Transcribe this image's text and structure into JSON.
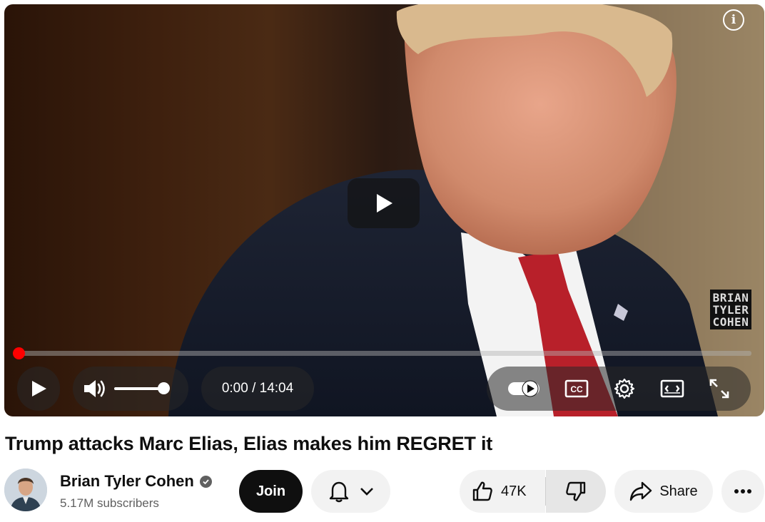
{
  "video": {
    "watermark": "BRIAN\nTYLER\nCOHEN",
    "progress_fraction": 0.0,
    "time": "0:00 / 14:04",
    "icons": [
      "info-icon",
      "play-icon",
      "volume-icon",
      "autoplay-toggle-icon",
      "cc-icon",
      "gear-icon",
      "miniplayer-icon",
      "fullscreen-icon"
    ]
  },
  "title": "Trump attacks Marc Elias, Elias makes him REGRET it",
  "channel": {
    "name": "Brian Tyler Cohen",
    "subscribers": "5.17M subscribers",
    "verified": true
  },
  "actions": {
    "join": "Join",
    "likes": "47K",
    "share": "Share"
  },
  "colors": {
    "progress": "#ff0000",
    "join_bg": "#0f0f0f",
    "button_bg": "#f2f2f2"
  }
}
